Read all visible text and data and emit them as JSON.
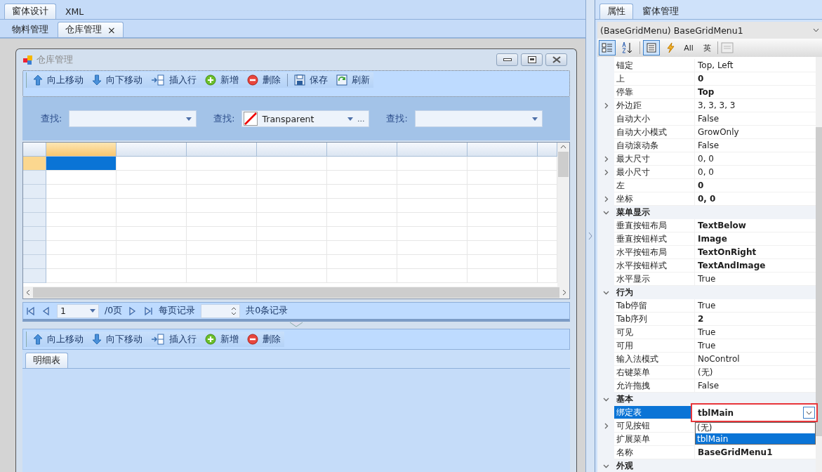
{
  "designer_tabs": [
    {
      "label": "窗体设计",
      "selected": true
    },
    {
      "label": "XML",
      "selected": false
    }
  ],
  "document_tabs": [
    {
      "label": "物料管理",
      "selected": false,
      "closable": false
    },
    {
      "label": "仓库管理",
      "selected": true,
      "closable": true,
      "close_glyph": "×"
    }
  ],
  "form": {
    "title": "仓库管理",
    "toolbar": [
      {
        "label": "向上移动"
      },
      {
        "label": "向下移动"
      },
      {
        "label": "插入行"
      },
      {
        "label": "新增"
      },
      {
        "label": "删除"
      },
      {
        "label": "保存"
      },
      {
        "label": "刷新"
      }
    ],
    "search_fields": [
      {
        "label": "查找:",
        "kind": "combo"
      },
      {
        "label": "查找:",
        "value": "Transparent",
        "kind": "color",
        "ellipsis": "..."
      },
      {
        "label": "查找:",
        "kind": "combo"
      }
    ],
    "grid_rows": [
      {
        "selected": true
      },
      {
        "selected": false
      },
      {
        "selected": false
      },
      {
        "selected": false
      },
      {
        "selected": false
      },
      {
        "selected": false
      },
      {
        "selected": false
      },
      {
        "selected": false
      },
      {
        "selected": false
      }
    ],
    "pager": {
      "page": "1",
      "pages": "/0页",
      "per_page_label": "每页记录",
      "total": "共0条记录"
    },
    "detail_toolbar": [
      {
        "label": "向上移动"
      },
      {
        "label": "向下移动"
      },
      {
        "label": "插入行"
      },
      {
        "label": "新增"
      },
      {
        "label": "删除"
      }
    ],
    "detail_tabs": [
      {
        "label": "明细表",
        "selected": true
      }
    ]
  },
  "side_tabs": [
    {
      "label": "属性",
      "selected": true
    },
    {
      "label": "窗体管理",
      "selected": false
    }
  ],
  "object_selector": "(BaseGridMenu) BaseGridMenu1",
  "prop_toolbar": {
    "categorized": true,
    "alphabetical": false,
    "properties": true,
    "events": false,
    "all_label": "All",
    "lang_label": "英"
  },
  "properties": [
    {
      "kind": "property",
      "name": "锚定",
      "value": "Top, Left",
      "bold": false,
      "expandable": false,
      "selected": false
    },
    {
      "kind": "property",
      "name": "上",
      "value": "0",
      "bold": true,
      "expandable": false,
      "selected": false
    },
    {
      "kind": "property",
      "name": "停靠",
      "value": "Top",
      "bold": true,
      "expandable": false,
      "selected": false
    },
    {
      "kind": "property",
      "name": "外边距",
      "value": "3, 3, 3, 3",
      "bold": false,
      "expandable": true,
      "selected": false
    },
    {
      "kind": "property",
      "name": "自动大小",
      "value": "False",
      "bold": false,
      "expandable": false,
      "selected": false
    },
    {
      "kind": "property",
      "name": "自动大小模式",
      "value": "GrowOnly",
      "bold": false,
      "expandable": false,
      "selected": false
    },
    {
      "kind": "property",
      "name": "自动滚动条",
      "value": "False",
      "bold": false,
      "expandable": false,
      "selected": false
    },
    {
      "kind": "property",
      "name": "最大尺寸",
      "value": "0, 0",
      "bold": false,
      "expandable": true,
      "selected": false
    },
    {
      "kind": "property",
      "name": "最小尺寸",
      "value": "0, 0",
      "bold": false,
      "expandable": true,
      "selected": false
    },
    {
      "kind": "property",
      "name": "左",
      "value": "0",
      "bold": true,
      "expandable": false,
      "selected": false
    },
    {
      "kind": "property",
      "name": "坐标",
      "value": "0, 0",
      "bold": true,
      "expandable": true,
      "selected": false
    },
    {
      "kind": "category",
      "name": "菜单显示",
      "expanded": true
    },
    {
      "kind": "property",
      "name": "垂直按钮布局",
      "value": "TextBelow",
      "bold": true,
      "expandable": false,
      "selected": false
    },
    {
      "kind": "property",
      "name": "垂直按钮样式",
      "value": "Image",
      "bold": true,
      "expandable": false,
      "selected": false
    },
    {
      "kind": "property",
      "name": "水平按钮布局",
      "value": "TextOnRight",
      "bold": true,
      "expandable": false,
      "selected": false
    },
    {
      "kind": "property",
      "name": "水平按钮样式",
      "value": "TextAndImage",
      "bold": true,
      "expandable": false,
      "selected": false
    },
    {
      "kind": "property",
      "name": "水平显示",
      "value": "True",
      "bold": false,
      "expandable": false,
      "selected": false
    },
    {
      "kind": "category",
      "name": "行为",
      "expanded": true
    },
    {
      "kind": "property",
      "name": "Tab停留",
      "value": "True",
      "bold": false,
      "expandable": false,
      "selected": false
    },
    {
      "kind": "property",
      "name": "Tab序列",
      "value": "2",
      "bold": true,
      "expandable": false,
      "selected": false
    },
    {
      "kind": "property",
      "name": "可见",
      "value": "True",
      "bold": false,
      "expandable": false,
      "selected": false
    },
    {
      "kind": "property",
      "name": "可用",
      "value": "True",
      "bold": false,
      "expandable": false,
      "selected": false
    },
    {
      "kind": "property",
      "name": "输入法模式",
      "value": "NoControl",
      "bold": false,
      "expandable": false,
      "selected": false
    },
    {
      "kind": "property",
      "name": "右键菜单",
      "value": "(无)",
      "bold": false,
      "expandable": false,
      "selected": false
    },
    {
      "kind": "property",
      "name": "允许拖拽",
      "value": "False",
      "bold": false,
      "expandable": false,
      "selected": false
    },
    {
      "kind": "category",
      "name": "基本",
      "expanded": true
    },
    {
      "kind": "property",
      "name": "绑定表",
      "value": "tblMain",
      "bold": true,
      "expandable": false,
      "selected": true,
      "options": [
        {
          "label": "(无)",
          "selected": false
        },
        {
          "label": "tblMain",
          "selected": true
        }
      ]
    },
    {
      "kind": "property",
      "name": "可见按钮",
      "expandable": true,
      "selected": false
    },
    {
      "kind": "property",
      "name": "扩展菜单",
      "expandable": false,
      "selected": false
    },
    {
      "kind": "property",
      "name": "名称",
      "value": "BaseGridMenu1",
      "bold": true,
      "expandable": false,
      "selected": false
    },
    {
      "kind": "category",
      "name": "外观",
      "expanded": true
    }
  ]
}
